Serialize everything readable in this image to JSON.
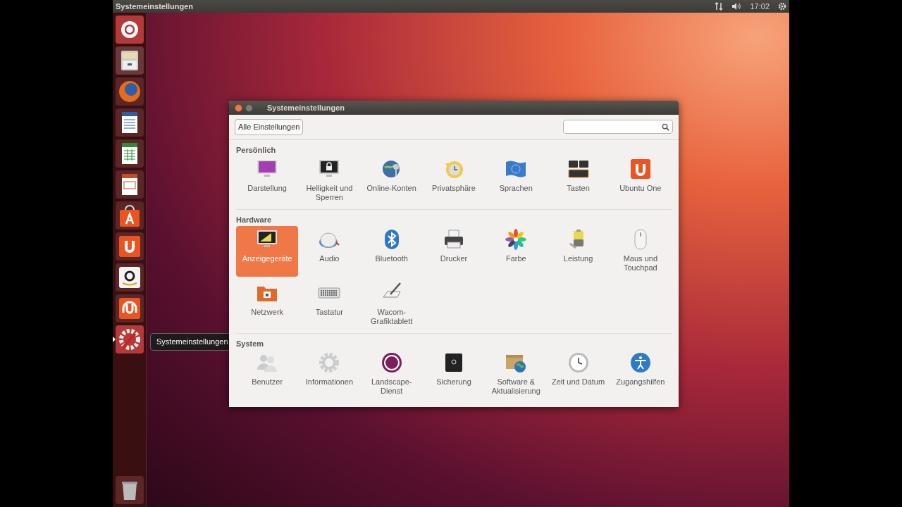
{
  "top_bar": {
    "title": "Systemeinstellungen",
    "clock": "17:02"
  },
  "launcher": [
    {
      "kind": "home",
      "running": false
    },
    {
      "kind": "files",
      "running": false
    },
    {
      "kind": "browser",
      "running": false
    },
    {
      "kind": "writer",
      "running": false
    },
    {
      "kind": "calc",
      "running": false
    },
    {
      "kind": "impress",
      "running": false
    },
    {
      "kind": "store",
      "running": false
    },
    {
      "kind": "ubuntu-one",
      "running": false
    },
    {
      "kind": "shop",
      "running": false
    },
    {
      "kind": "music",
      "running": false
    },
    {
      "kind": "settings",
      "running": true
    },
    {
      "kind": "trash",
      "running": false
    }
  ],
  "tooltip": "Systemeinstellungen",
  "window": {
    "title": "Systemeinstellungen",
    "all_settings_button": "Alle Einstellungen",
    "sections": [
      {
        "title": "Persönlich",
        "items": [
          {
            "kind": "appearance",
            "label": "Darstellung",
            "selected": false
          },
          {
            "kind": "brightness",
            "label": "Helligkeit und Sperren",
            "selected": false
          },
          {
            "kind": "online-accounts",
            "label": "Online-Konten",
            "selected": false
          },
          {
            "kind": "privacy",
            "label": "Privatsphäre",
            "selected": false
          },
          {
            "kind": "language",
            "label": "Sprachen",
            "selected": false
          },
          {
            "kind": "shortcuts",
            "label": "Tasten",
            "selected": false
          },
          {
            "kind": "ubuntu-one",
            "label": "Ubuntu One",
            "selected": false
          }
        ]
      },
      {
        "title": "Hardware",
        "items": [
          {
            "kind": "display",
            "label": "Anzeigegeräte",
            "selected": true
          },
          {
            "kind": "audio",
            "label": "Audio",
            "selected": false
          },
          {
            "kind": "bluetooth",
            "label": "Bluetooth",
            "selected": false
          },
          {
            "kind": "printer",
            "label": "Drucker",
            "selected": false
          },
          {
            "kind": "color",
            "label": "Farbe",
            "selected": false
          },
          {
            "kind": "power",
            "label": "Leistung",
            "selected": false
          },
          {
            "kind": "mouse",
            "label": "Maus und Touchpad",
            "selected": false
          },
          {
            "kind": "network",
            "label": "Netzwerk",
            "selected": false
          },
          {
            "kind": "keyboard",
            "label": "Tastatur",
            "selected": false
          },
          {
            "kind": "wacom",
            "label": "Wacom-Grafiktablett",
            "selected": false
          }
        ]
      },
      {
        "title": "System",
        "items": [
          {
            "kind": "users",
            "label": "Benutzer",
            "selected": false
          },
          {
            "kind": "info",
            "label": "Informationen",
            "selected": false
          },
          {
            "kind": "landscape",
            "label": "Landscape-Dienst",
            "selected": false
          },
          {
            "kind": "backup",
            "label": "Sicherung",
            "selected": false
          },
          {
            "kind": "software",
            "label": "Software & Aktualisierung",
            "selected": false
          },
          {
            "kind": "time",
            "label": "Zeit und Datum",
            "selected": false
          },
          {
            "kind": "accessibility",
            "label": "Zugangshilfen",
            "selected": false
          }
        ]
      }
    ]
  }
}
